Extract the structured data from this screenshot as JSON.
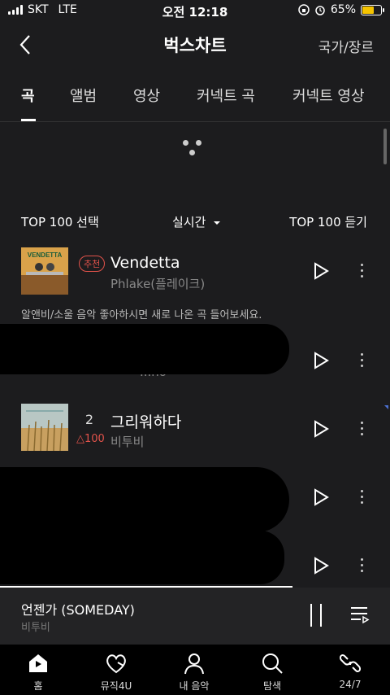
{
  "status": {
    "carrier": "SKT",
    "network": "LTE",
    "time": "오전 12:18",
    "battery_percent": "65%",
    "battery_level": 0.65,
    "battery_color": "#f5c400"
  },
  "header": {
    "title": "벅스차트",
    "right_action": "국가/장르",
    "back_icon": "chevron-left-icon"
  },
  "tabs": [
    {
      "label": "곡",
      "active": true
    },
    {
      "label": "앨범",
      "active": false
    },
    {
      "label": "영상",
      "active": false
    },
    {
      "label": "커넥트 곡",
      "active": false
    },
    {
      "label": "커넥트 영상",
      "active": false
    }
  ],
  "list_header": {
    "select_label": "TOP 100 선택",
    "period_label": "실시간",
    "listen_label": "TOP 100 듣기"
  },
  "songs": [
    {
      "badge": "추천",
      "title": "Vendetta",
      "artist": "Phlake(플레이크)",
      "description": "알앤비/소울 음악 좋아하시면 새로 나온 곡 들어보세요.",
      "thumb_label": "VENDETTA"
    },
    {
      "artist_partial": "...no"
    },
    {
      "rank": "2",
      "rank_change": "△100",
      "title": "그리워하다",
      "artist": "비투비"
    },
    {
      "title": ""
    },
    {
      "title_partial": "..."
    }
  ],
  "mini_player": {
    "title": "언젠가 (SOMEDAY)",
    "artist": "비투비",
    "progress": 0.75
  },
  "bottom_nav": [
    {
      "label": "홈",
      "icon": "home-icon"
    },
    {
      "label": "뮤직4U",
      "icon": "heart-music-icon"
    },
    {
      "label": "내 음악",
      "icon": "user-icon"
    },
    {
      "label": "탐색",
      "icon": "search-icon"
    },
    {
      "label": "24/7",
      "icon": "loop-icon"
    }
  ],
  "colors": {
    "accent_red": "#e0524a",
    "background": "#1c1c1e",
    "marker_blue": "#4b6fd0"
  }
}
